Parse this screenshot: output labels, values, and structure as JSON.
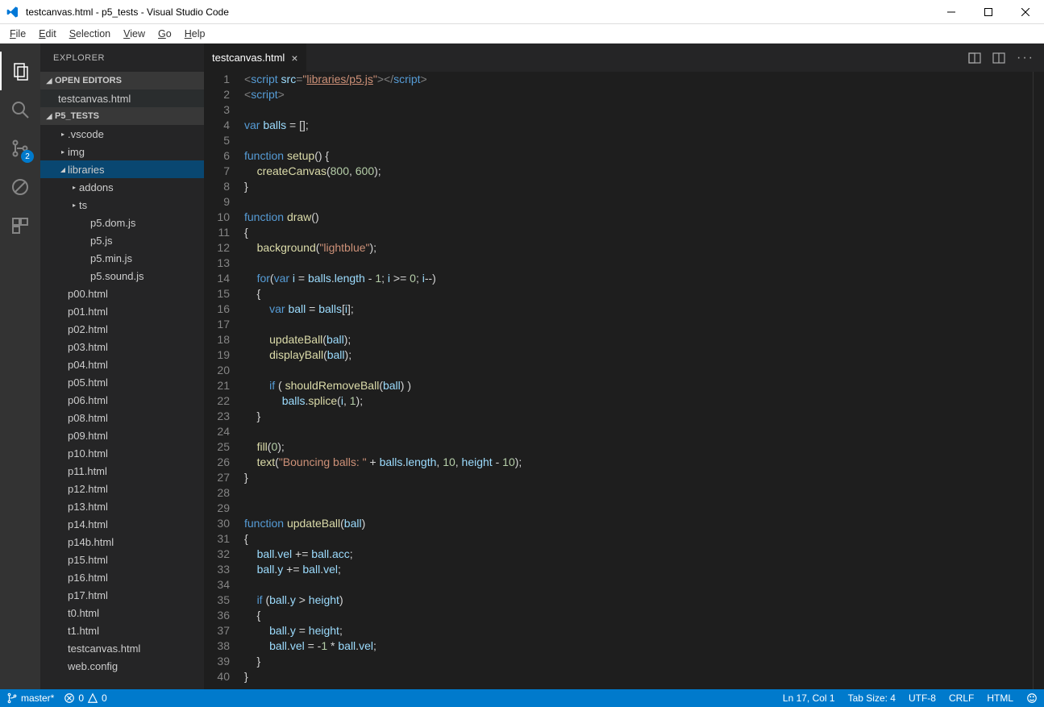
{
  "window": {
    "title": "testcanvas.html - p5_tests - Visual Studio Code"
  },
  "menu": [
    "File",
    "Edit",
    "Selection",
    "View",
    "Go",
    "Help"
  ],
  "activity_badge": "2",
  "sidebar": {
    "title": "EXPLORER",
    "sections": {
      "open_editors": "OPEN EDITORS",
      "open_editor_item": "testcanvas.html",
      "project": "P5_TESTS"
    },
    "tree": [
      {
        "depth": 1,
        "chev": "▸",
        "name": ".vscode"
      },
      {
        "depth": 1,
        "chev": "▸",
        "name": "img"
      },
      {
        "depth": 1,
        "chev": "◢",
        "name": "libraries",
        "selected": true
      },
      {
        "depth": 2,
        "chev": "▸",
        "name": "addons"
      },
      {
        "depth": 2,
        "chev": "▸",
        "name": "ts"
      },
      {
        "depth": 3,
        "chev": "",
        "name": "p5.dom.js"
      },
      {
        "depth": 3,
        "chev": "",
        "name": "p5.js"
      },
      {
        "depth": 3,
        "chev": "",
        "name": "p5.min.js"
      },
      {
        "depth": 3,
        "chev": "",
        "name": "p5.sound.js"
      },
      {
        "depth": 1,
        "chev": "",
        "name": "p00.html"
      },
      {
        "depth": 1,
        "chev": "",
        "name": "p01.html"
      },
      {
        "depth": 1,
        "chev": "",
        "name": "p02.html"
      },
      {
        "depth": 1,
        "chev": "",
        "name": "p03.html"
      },
      {
        "depth": 1,
        "chev": "",
        "name": "p04.html"
      },
      {
        "depth": 1,
        "chev": "",
        "name": "p05.html"
      },
      {
        "depth": 1,
        "chev": "",
        "name": "p06.html"
      },
      {
        "depth": 1,
        "chev": "",
        "name": "p08.html"
      },
      {
        "depth": 1,
        "chev": "",
        "name": "p09.html"
      },
      {
        "depth": 1,
        "chev": "",
        "name": "p10.html"
      },
      {
        "depth": 1,
        "chev": "",
        "name": "p11.html"
      },
      {
        "depth": 1,
        "chev": "",
        "name": "p12.html"
      },
      {
        "depth": 1,
        "chev": "",
        "name": "p13.html"
      },
      {
        "depth": 1,
        "chev": "",
        "name": "p14.html"
      },
      {
        "depth": 1,
        "chev": "",
        "name": "p14b.html"
      },
      {
        "depth": 1,
        "chev": "",
        "name": "p15.html"
      },
      {
        "depth": 1,
        "chev": "",
        "name": "p16.html"
      },
      {
        "depth": 1,
        "chev": "",
        "name": "p17.html"
      },
      {
        "depth": 1,
        "chev": "",
        "name": "t0.html"
      },
      {
        "depth": 1,
        "chev": "",
        "name": "t1.html"
      },
      {
        "depth": 1,
        "chev": "",
        "name": "testcanvas.html"
      },
      {
        "depth": 1,
        "chev": "",
        "name": "web.config"
      }
    ]
  },
  "tab": {
    "name": "testcanvas.html"
  },
  "code_lines_start": 1,
  "code_lines_end": 40,
  "highlight_line": 17,
  "statusbar": {
    "branch": "master*",
    "errors": "0",
    "warnings": "0",
    "ln_col": "Ln 17, Col 1",
    "tab_size": "Tab Size: 4",
    "encoding": "UTF-8",
    "eol": "CRLF",
    "lang": "HTML"
  }
}
